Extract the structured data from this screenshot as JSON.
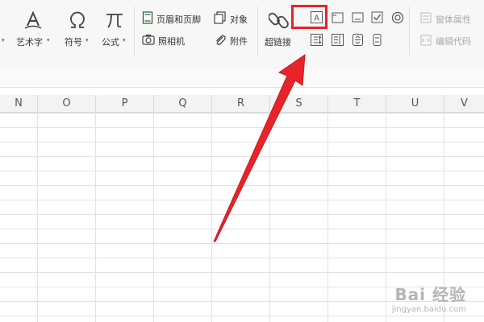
{
  "ribbon": {
    "wordart_label": "艺术字",
    "symbol_label": "符号",
    "formula_label": "公式",
    "header_footer_label": "页眉和页脚",
    "camera_label": "照相机",
    "object_label": "对象",
    "attachment_label": "附件",
    "hyperlink_label": "超链接",
    "form_properties_label": "窗体属性",
    "edit_code_label": "编辑代码"
  },
  "columns": [
    "N",
    "O",
    "P",
    "Q",
    "R",
    "S",
    "T",
    "U",
    "V"
  ],
  "watermark": {
    "main": "Bai 经验",
    "sub": "jingyan.baidu.com"
  },
  "colors": {
    "highlight": "#e8242a",
    "arrow": "#e8242a"
  },
  "icons": [
    "wordart-icon",
    "symbol-omega-icon",
    "formula-pi-icon",
    "header-footer-icon",
    "camera-icon",
    "object-icon",
    "attachment-paperclip-icon",
    "hyperlink-chain-icon",
    "label-control-icon",
    "frame-control-icon",
    "textbox-control-icon",
    "checkbox-control-icon",
    "radio-control-icon",
    "spin-control-icon",
    "list-control-icon",
    "combo-control-icon",
    "scroll-control-icon"
  ]
}
